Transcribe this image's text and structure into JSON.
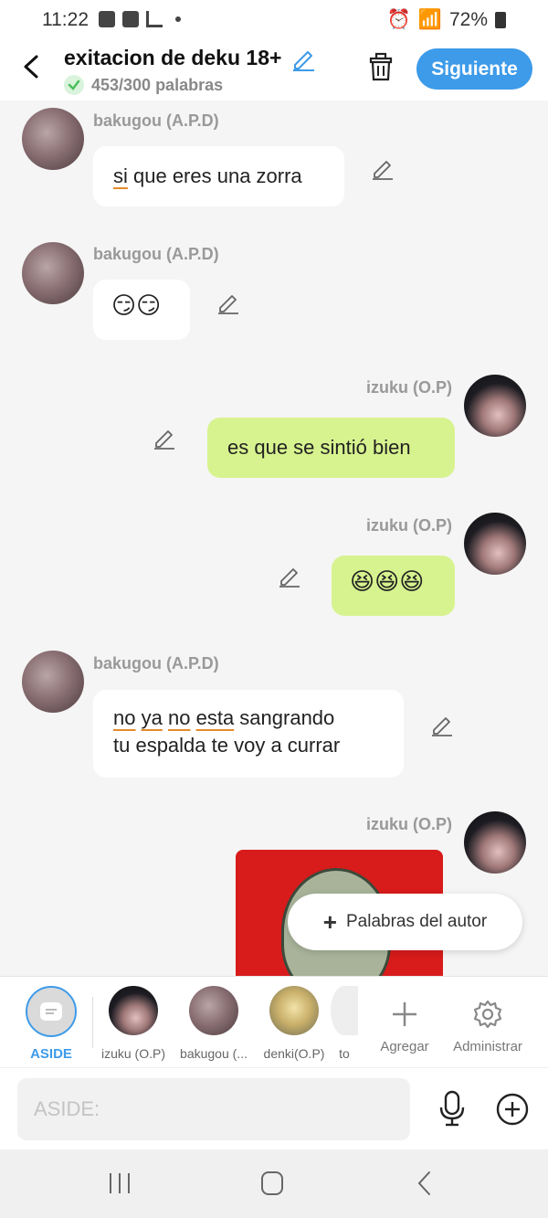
{
  "status_bar": {
    "time": "11:22",
    "battery": "72%"
  },
  "header": {
    "title": "exitacion de deku 18+",
    "word_count": "453/300 palabras",
    "next_button": "Siguiente"
  },
  "messages": [
    {
      "side": "left",
      "author": "bakugou (A.P.D)",
      "text": "si que eres una zorra"
    },
    {
      "side": "left",
      "author": "bakugou (A.P.D)",
      "text": "😏😏"
    },
    {
      "side": "right",
      "author": "izuku (O.P)",
      "text": "es que se sintió bien"
    },
    {
      "side": "right",
      "author": "izuku (O.P)",
      "text": "😆😆😆"
    },
    {
      "side": "left",
      "author": "bakugou (A.P.D)",
      "text_lines": [
        "no ya no esta sangrando",
        "tu espalda te voy a currar"
      ]
    },
    {
      "side": "right",
      "author": "izuku (O.P)",
      "type": "image"
    }
  ],
  "fab": {
    "label": "Palabras del autor"
  },
  "characters": [
    {
      "label": "ASIDE",
      "icon": "aside-icon"
    },
    {
      "label": "izuku (O.P)"
    },
    {
      "label": "bakugou (..."
    },
    {
      "label": "denki(O.P)"
    },
    {
      "label": "to"
    }
  ],
  "tools": {
    "add": "Agregar",
    "manage": "Administrar"
  },
  "input": {
    "placeholder": "ASIDE:"
  },
  "colors": {
    "accent": "#3d9be9",
    "own_bubble": "#d7f38f",
    "other_bubble": "#ffffff",
    "image_bg": "#d81b1b"
  }
}
